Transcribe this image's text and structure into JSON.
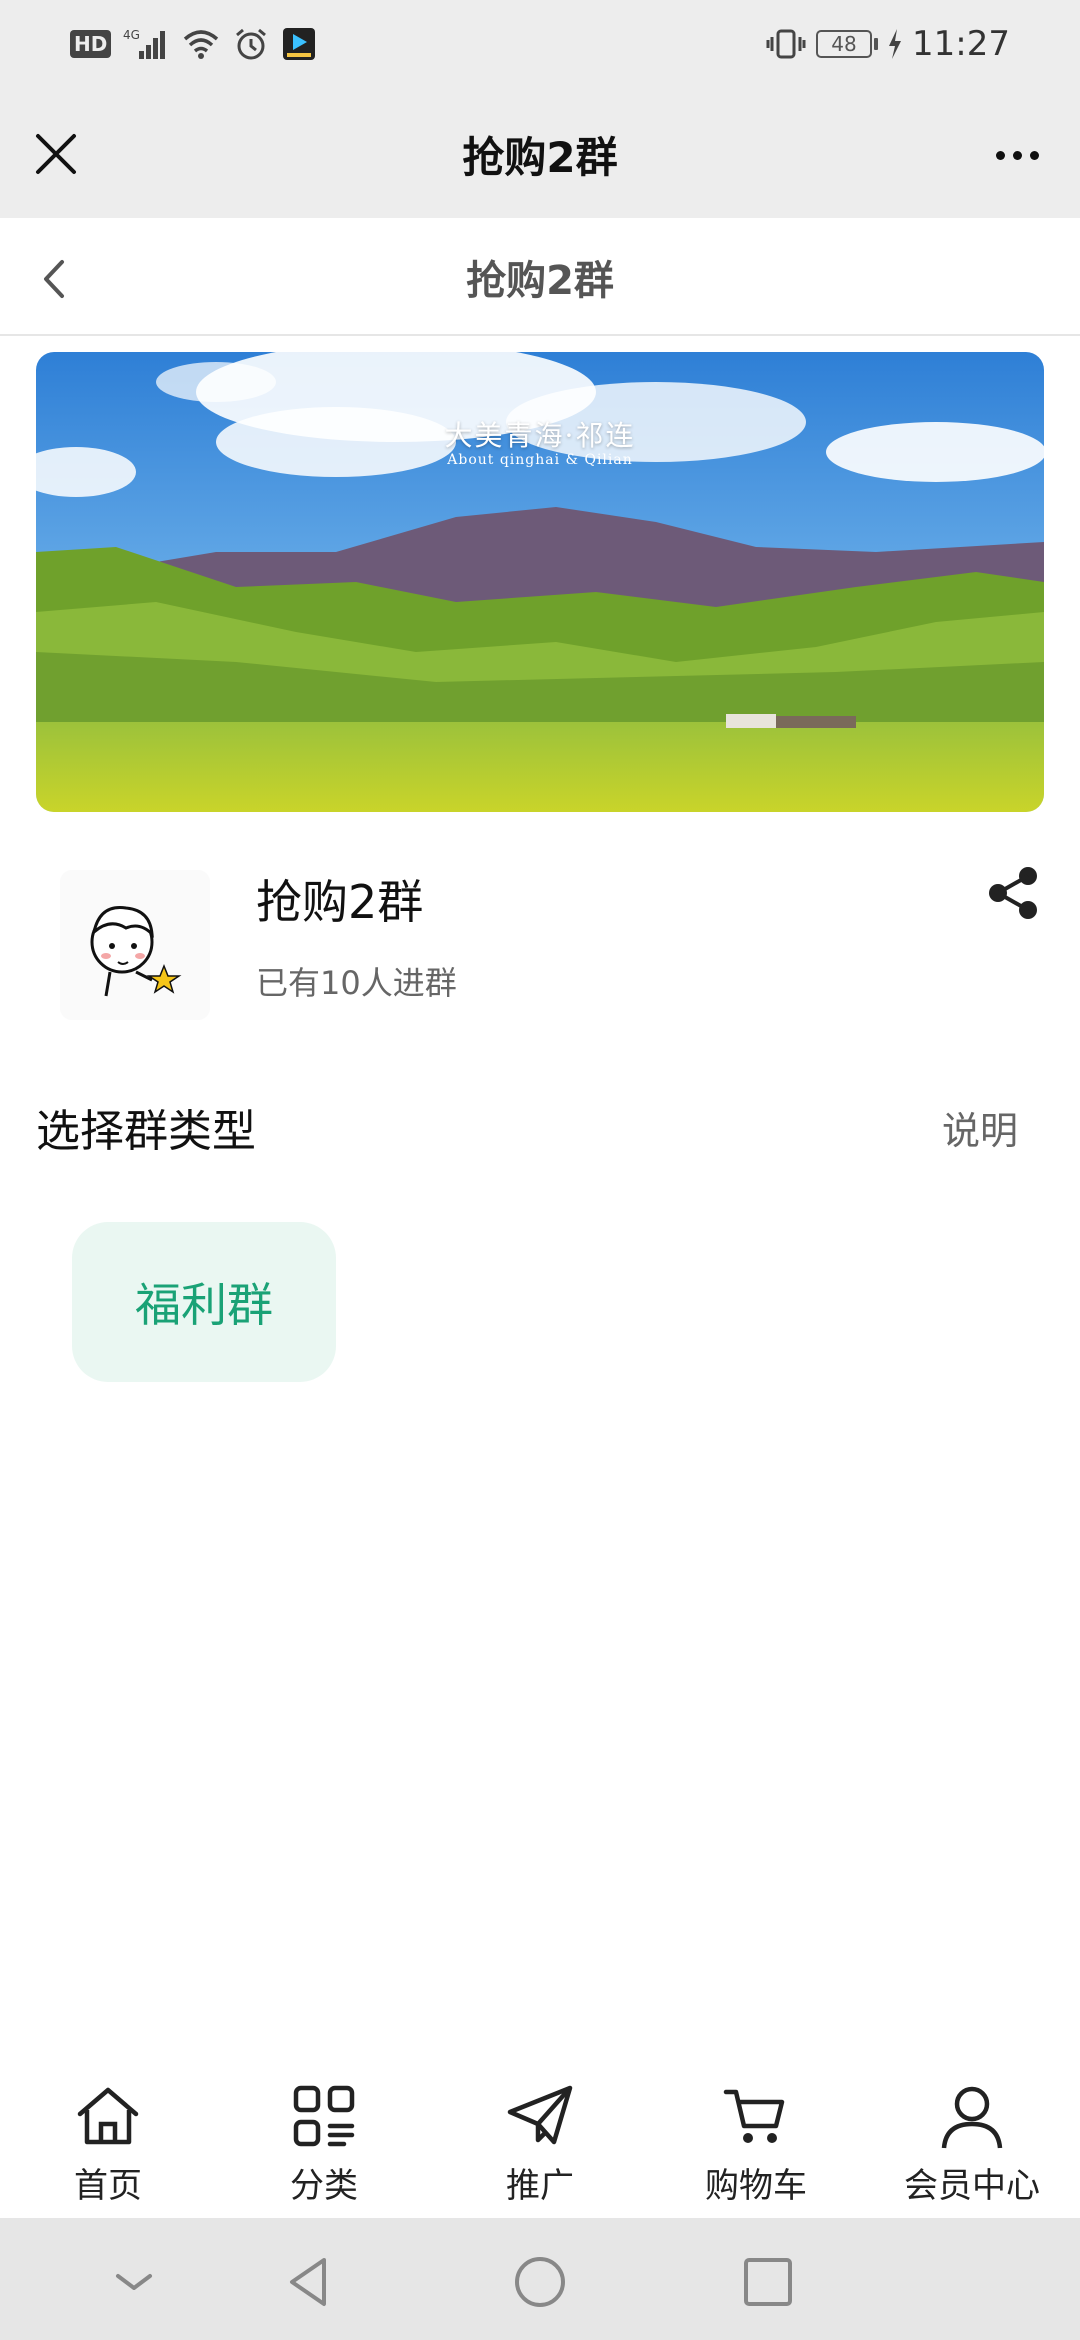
{
  "status_bar": {
    "left_icons": [
      "hd-icon",
      "4g-signal-icon",
      "wifi-icon",
      "alarm-icon",
      "app-notification-icon"
    ],
    "hd_label": "HD",
    "network_label": "4G",
    "battery_level": "48",
    "time": "11:27"
  },
  "topbar": {
    "title": "抢购2群"
  },
  "page_header": {
    "title": "抢购2群"
  },
  "banner": {
    "caption": "大美青海·祁连",
    "subcaption": "About qinghai & Qilian"
  },
  "group": {
    "name": "抢购2群",
    "member_count": "已有10人进群"
  },
  "section": {
    "title": "选择群类型",
    "link": "说明"
  },
  "group_types": [
    {
      "label": "福利群",
      "selected": true
    }
  ],
  "tabbar": {
    "items": [
      {
        "label": "首页",
        "icon": "home-icon"
      },
      {
        "label": "分类",
        "icon": "category-icon"
      },
      {
        "label": "推广",
        "icon": "paper-plane-icon"
      },
      {
        "label": "购物车",
        "icon": "cart-icon"
      },
      {
        "label": "会员中心",
        "icon": "user-icon"
      }
    ]
  },
  "colors": {
    "accent": "#1aa276",
    "chip_bg": "#eaf7f2",
    "bar_bg": "#ededed"
  }
}
